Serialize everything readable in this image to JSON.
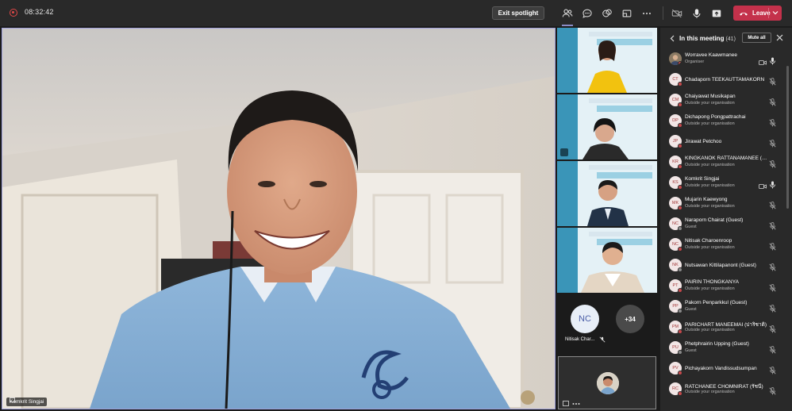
{
  "topbar": {
    "timer": "08:32:42",
    "exit_spotlight_label": "Exit spotlight",
    "leave_label": "Leave"
  },
  "main_video": {
    "name_tag": "Komkrit Singjai"
  },
  "thumbnails": {
    "nc_initials": "NC",
    "nc_name": "Nitisak Char...",
    "more_count": "+34"
  },
  "panel": {
    "title": "In this meeting",
    "count": "(41)",
    "mute_all_label": "Mute all",
    "participants": [
      {
        "initials": "",
        "name": "Worravee Kaawmanee",
        "sub": "Organiser",
        "photo": true,
        "cam": true,
        "mic": "on"
      },
      {
        "initials": "CT",
        "name": "Chadaporn TEEKAUTTAMAKORN",
        "sub": "",
        "mic": "off"
      },
      {
        "initials": "CM",
        "name": "Chaiyawat Musikapan",
        "sub": "Outside your organisation",
        "mic": "off"
      },
      {
        "initials": "DP",
        "name": "Dichapong Pongpattrachai",
        "sub": "Outside your organisation",
        "mic": "off"
      },
      {
        "initials": "JP",
        "name": "Jirawat Petchoo",
        "sub": "",
        "mic": "off"
      },
      {
        "initials": "KR",
        "name": "KINGKANOK RATTANAMANEE (Guest)",
        "sub": "Outside your organisation",
        "mic": "off"
      },
      {
        "initials": "KS",
        "name": "Komkrit Singjai",
        "sub": "Outside your organisation",
        "cam": true,
        "mic": "on"
      },
      {
        "initials": "MK",
        "name": "Mujarin Kaewyong",
        "sub": "Outside your organisation",
        "mic": "off"
      },
      {
        "initials": "NC",
        "name": "Naraporn Chairat (Guest)",
        "sub": "Guest",
        "gray": true,
        "mic": "off"
      },
      {
        "initials": "NC",
        "name": "Nitisak Charoenroop",
        "sub": "Outside your organisation",
        "mic": "off"
      },
      {
        "initials": "NK",
        "name": "Nutsawan Kittilapanont (Guest)",
        "sub": "",
        "gray": true,
        "mic": "off"
      },
      {
        "initials": "PT",
        "name": "PAIRIN THONGKANYA",
        "sub": "Outside your organisation",
        "mic": "off"
      },
      {
        "initials": "PP",
        "name": "Pakorn Penparkkul (Guest)",
        "sub": "Guest",
        "gray": true,
        "mic": "off"
      },
      {
        "initials": "PM",
        "name": "PARICHART MANEEMAI (ปาริชาติ)",
        "sub": "Outside your organisation",
        "mic": "off"
      },
      {
        "initials": "PU",
        "name": "Phetphrairin Upping (Guest)",
        "sub": "Guest",
        "gray": true,
        "mic": "off"
      },
      {
        "initials": "PV",
        "name": "Pichayakorn Vandissudsumpan",
        "sub": "",
        "mic": "off"
      },
      {
        "initials": "RC",
        "name": "RATCHANEE CHOMNIRAT (รัชนี)",
        "sub": "Outside your organisation",
        "mic": "off"
      }
    ]
  },
  "colors": {
    "accent": "#8b8cc7",
    "leave": "#c4314b",
    "panel_bg": "#292929",
    "status_red": "#c5484b"
  }
}
